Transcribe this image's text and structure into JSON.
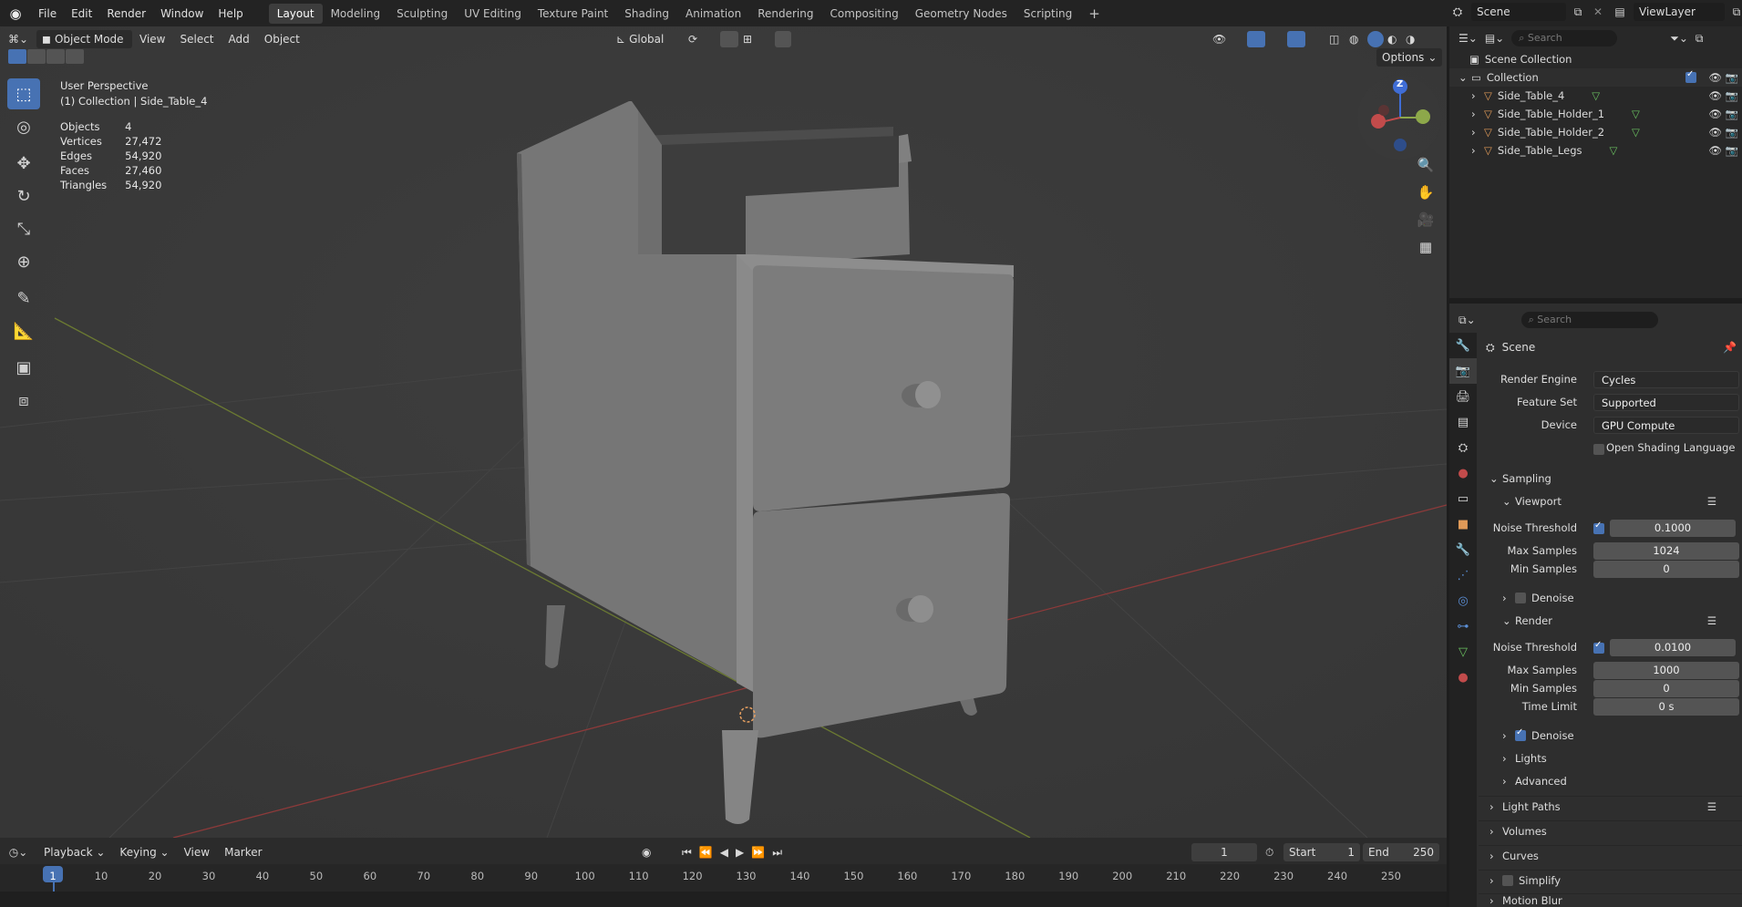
{
  "topbar": {
    "menus": [
      "File",
      "Edit",
      "Render",
      "Window",
      "Help"
    ],
    "workspaces": [
      "Layout",
      "Modeling",
      "Sculpting",
      "UV Editing",
      "Texture Paint",
      "Shading",
      "Animation",
      "Rendering",
      "Compositing",
      "Geometry Nodes",
      "Scripting"
    ],
    "active_workspace": "Layout",
    "add_label": "+",
    "scene": "Scene",
    "view_layer": "ViewLayer"
  },
  "viewport": {
    "mode": "Object Mode",
    "menus": [
      "View",
      "Select",
      "Add",
      "Object"
    ],
    "orientation": "Global",
    "options": "Options",
    "overlay_title": "User Perspective",
    "overlay_sub": "(1) Collection | Side_Table_4",
    "stats": [
      {
        "k": "Objects",
        "v": "4"
      },
      {
        "k": "Vertices",
        "v": "27,472"
      },
      {
        "k": "Edges",
        "v": "54,920"
      },
      {
        "k": "Faces",
        "v": "27,460"
      },
      {
        "k": "Triangles",
        "v": "54,920"
      }
    ],
    "gizmo": {
      "z": "Z"
    }
  },
  "outliner": {
    "search": "Search",
    "scene_collection": "Scene Collection",
    "collection": "Collection",
    "items": [
      "Side_Table_4",
      "Side_Table_Holder_1",
      "Side_Table_Holder_2",
      "Side_Table_Legs"
    ]
  },
  "properties": {
    "search": "Search",
    "context": "Scene",
    "render_engine": {
      "label": "Render Engine",
      "value": "Cycles"
    },
    "feature_set": {
      "label": "Feature Set",
      "value": "Supported"
    },
    "device": {
      "label": "Device",
      "value": "GPU Compute"
    },
    "osl": "Open Shading Language",
    "sampling": "Sampling",
    "viewport_sec": "Viewport",
    "v_noise": {
      "label": "Noise Threshold",
      "value": "0.1000"
    },
    "v_max": {
      "label": "Max Samples",
      "value": "1024"
    },
    "v_min": {
      "label": "Min Samples",
      "value": "0"
    },
    "v_denoise": "Denoise",
    "render_sec": "Render",
    "r_noise": {
      "label": "Noise Threshold",
      "value": "0.0100"
    },
    "r_max": {
      "label": "Max Samples",
      "value": "1000"
    },
    "r_min": {
      "label": "Min Samples",
      "value": "0"
    },
    "r_time": {
      "label": "Time Limit",
      "value": "0 s"
    },
    "r_denoise": "Denoise",
    "lights": "Lights",
    "advanced": "Advanced",
    "light_paths": "Light Paths",
    "volumes": "Volumes",
    "curves": "Curves",
    "simplify": "Simplify",
    "motion_blur": "Motion Blur"
  },
  "timeline": {
    "menus": [
      "Playback",
      "Keying",
      "View",
      "Marker"
    ],
    "current": "1",
    "start_label": "Start",
    "start": "1",
    "end_label": "End",
    "end": "250",
    "ticks": [
      "1",
      "10",
      "20",
      "30",
      "40",
      "50",
      "60",
      "70",
      "80",
      "90",
      "100",
      "110",
      "120",
      "130",
      "140",
      "150",
      "160",
      "170",
      "180",
      "190",
      "200",
      "210",
      "220",
      "230",
      "240",
      "250"
    ]
  }
}
